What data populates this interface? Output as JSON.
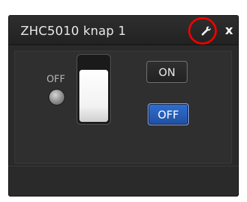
{
  "window": {
    "title": "ZHC5010 knap 1",
    "settings_icon": "wrench-icon",
    "close_label": "x"
  },
  "status": {
    "label": "OFF",
    "indicator_color": "#8a8a8a"
  },
  "buttons": {
    "on_label": "ON",
    "off_label": "OFF",
    "active": "OFF",
    "active_color": "#2f6ed1"
  },
  "highlight": {
    "color": "#ee0000"
  }
}
